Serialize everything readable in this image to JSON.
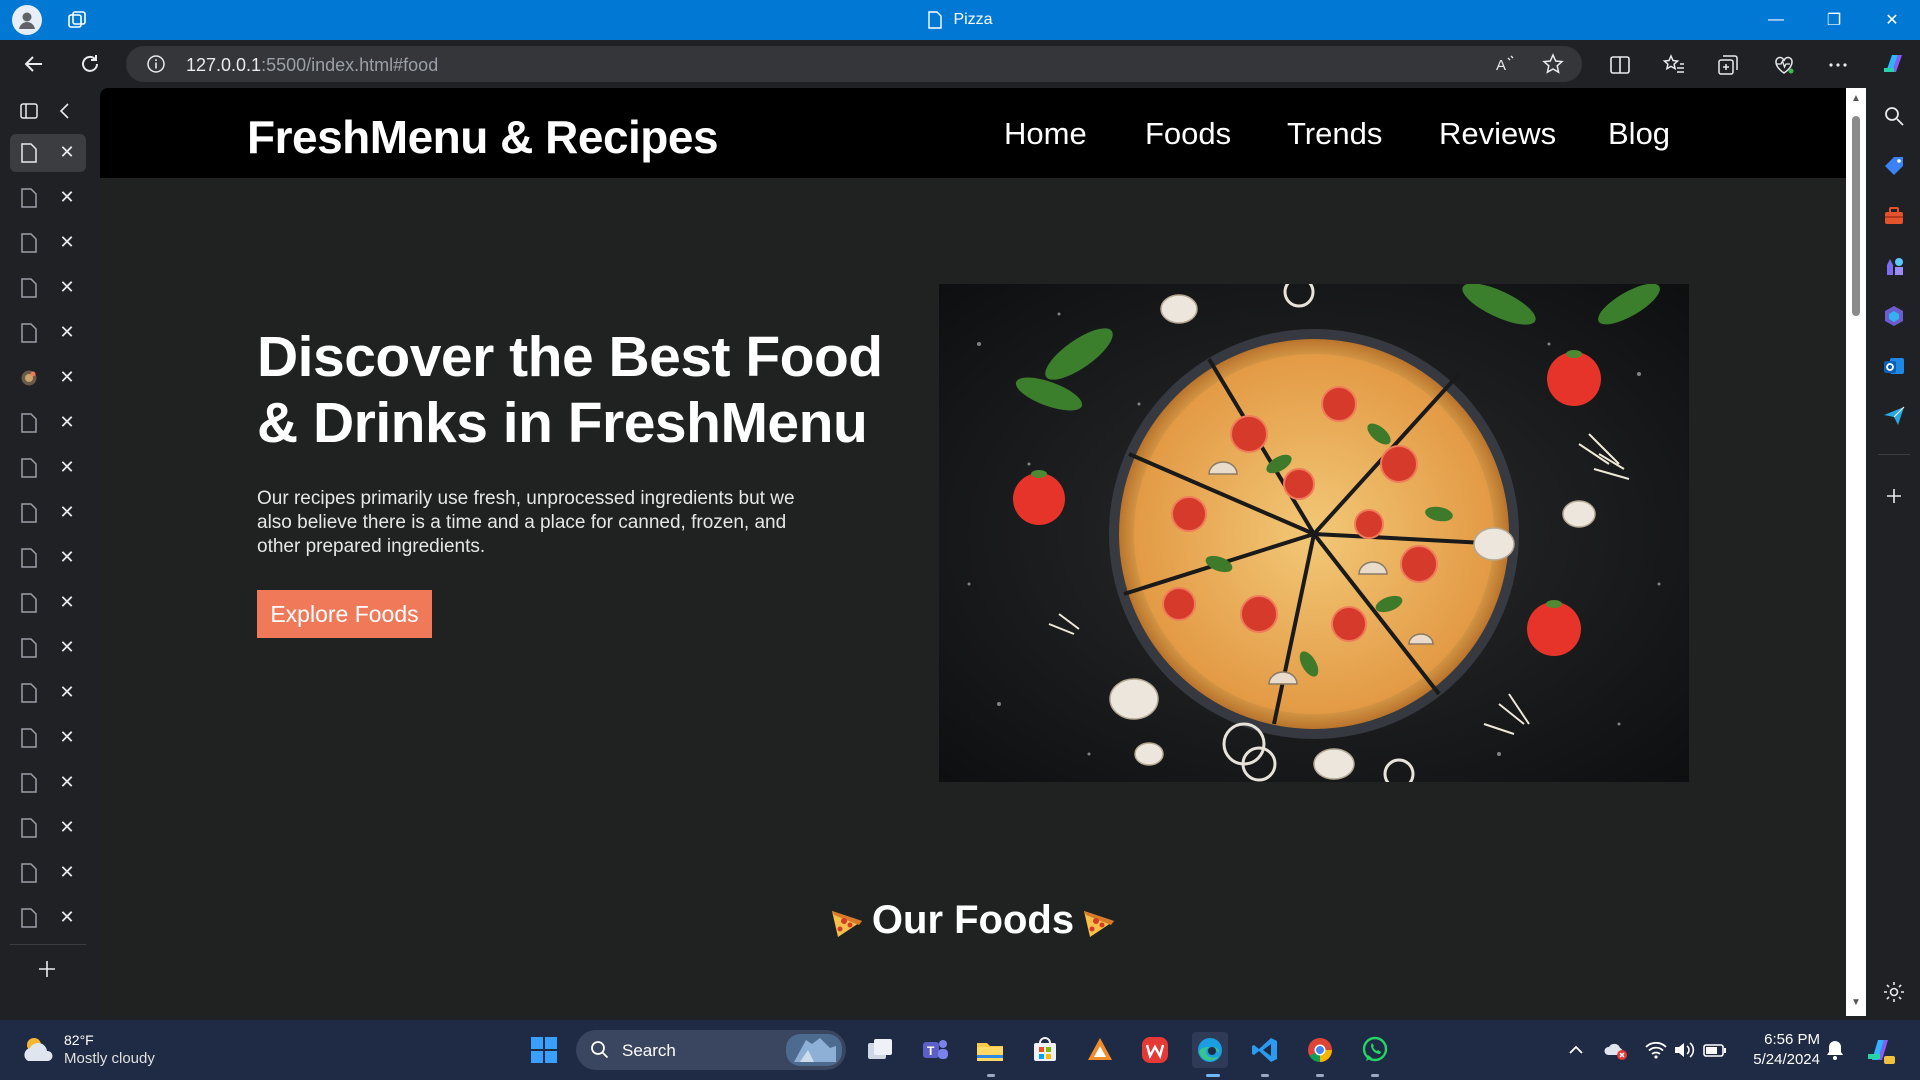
{
  "browser": {
    "window_title": "Pizza",
    "url_host": "127.0.0.1",
    "url_rest": ":5500/index.html#food"
  },
  "site": {
    "logo": "FreshMenu & Recipes",
    "nav": [
      "Home",
      "Foods",
      "Trends",
      "Reviews",
      "Blog"
    ],
    "hero": {
      "title": "Discover the Best Food & Drinks in FreshMenu",
      "text": "Our recipes primarily use fresh, unprocessed ingredients but we also believe there is a time and a place for canned, frozen, and other prepared ingredients.",
      "cta": "Explore Foods"
    },
    "section_title": "Our Foods",
    "accent_color": "#f0795a"
  },
  "taskbar": {
    "weather_temp": "82°F",
    "weather_cond": "Mostly cloudy",
    "search_label": "Search",
    "time": "6:56 PM",
    "date": "5/24/2024"
  }
}
